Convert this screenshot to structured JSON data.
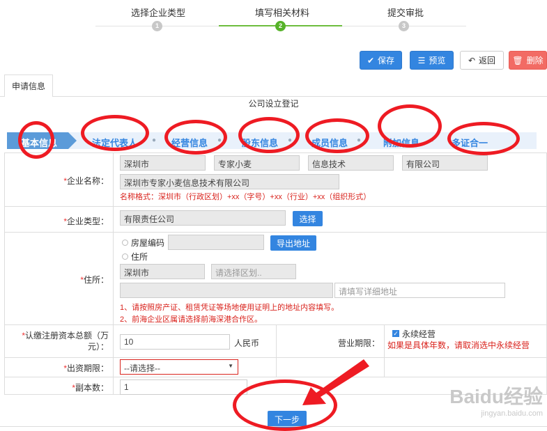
{
  "steps": [
    {
      "label": "选择企业类型",
      "num": "1"
    },
    {
      "label": "填写相关材料",
      "num": "2"
    },
    {
      "label": "提交审批",
      "num": "3"
    }
  ],
  "toolbar": {
    "save": "保存",
    "preview": "预览",
    "back": "返回",
    "delete": "删除"
  },
  "tab": "申请信息",
  "section_title": "公司设立登记",
  "subnav": [
    "基本信息",
    "法定代表人",
    "经营信息",
    "股东信息",
    "成员信息",
    "附加信息",
    "多证合一"
  ],
  "form": {
    "name_label": "企业名称：",
    "name_parts": [
      "深圳市",
      "专家小麦",
      "信息技术",
      "有限公司"
    ],
    "name_full": "深圳市专家小麦信息技术有限公司",
    "name_hint": "名称格式：深圳市（行政区划）+xx（字号）+xx（行业）+xx（组织形式）",
    "type_label": "企业类型：",
    "type_value": "有限责任公司",
    "type_button": "选择",
    "address_label": "住所：",
    "radio_house": "房屋编码",
    "export_button": "导出地址",
    "radio_live": "住所",
    "city": "深圳市",
    "district_placeholder": "请选择区划..",
    "detail_placeholder": "请填写详细地址",
    "addr_hint1": "1、请按照房产证、租赁凭证等场地使用证明上的地址内容填写。",
    "addr_hint2": "2、前海企业区属请选择前海深港合作区。",
    "capital_label": "认缴注册资本总额（万元）：",
    "capital_value": "10",
    "capital_unit": "人民币",
    "period_label": "营业期限：",
    "period_check": "永续经营",
    "period_hint": "如果是具体年数，请取消选中永续经营",
    "term_label": "出资期限：",
    "term_select": "--请选择--",
    "copies_label": "副本数：",
    "copies_value": "1"
  },
  "next_button": "下一步",
  "watermark": {
    "logo": "Baidu经验",
    "url": "jingyan.baidu.com"
  },
  "colors": {
    "primary": "#3385e0",
    "danger": "#f26b64",
    "step_active": "#56b229",
    "annotation": "#ee1b23",
    "hint": "#d9221c"
  }
}
